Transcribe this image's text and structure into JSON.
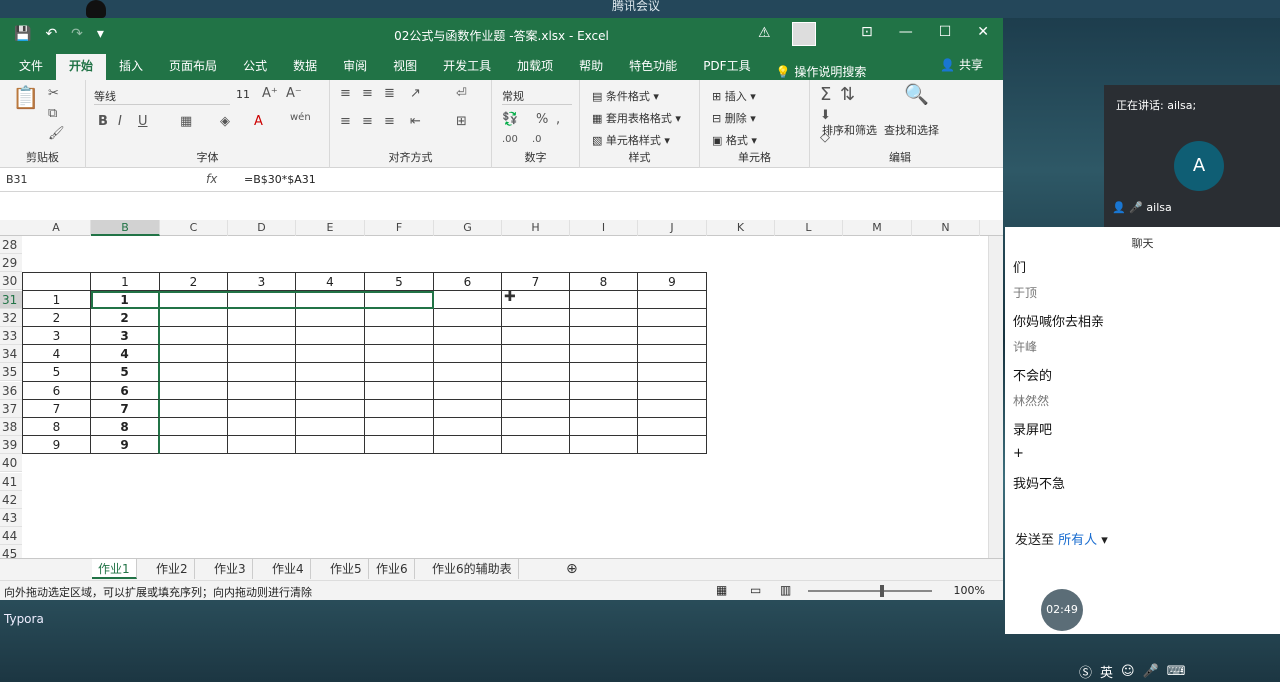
{
  "desktop": {
    "meeting_app": "腾讯会议",
    "typora": "Typora"
  },
  "window": {
    "title": "02公式与函数作业题 -答案.xlsx  -  Excel",
    "controls": [
      "⊡",
      "—",
      "☐",
      "✕"
    ]
  },
  "ribbon_tabs": [
    "文件",
    "开始",
    "插入",
    "页面布局",
    "公式",
    "数据",
    "审阅",
    "视图",
    "开发工具",
    "加载项",
    "帮助",
    "特色功能",
    "PDF工具"
  ],
  "active_tab": "开始",
  "tell_me": "操作说明搜索",
  "share": "共享",
  "ribbon": {
    "clipboard": "剪贴板",
    "font_group": "字体",
    "font_name": "等线",
    "font_size": "11",
    "align_group": "对齐方式",
    "number_group": "数字",
    "number_format": "常规",
    "styles_group": "样式",
    "cond_format": "条件格式",
    "table_format": "套用表格格式",
    "cell_styles": "单元格样式",
    "cells_group": "单元格",
    "insert": "插入",
    "delete": "删除",
    "format": "格式",
    "edit_group": "编辑",
    "sort_filter": "排序和筛选",
    "find_select": "查找和选择"
  },
  "formula_bar": {
    "name_box": "B31",
    "fx": "fx",
    "formula": "=B$30*$A31"
  },
  "columns": [
    "A",
    "B",
    "C",
    "D",
    "E",
    "F",
    "G",
    "H",
    "I",
    "J",
    "K",
    "L",
    "M",
    "N"
  ],
  "rows": [
    "28",
    "29",
    "30",
    "31",
    "32",
    "33",
    "34",
    "35",
    "36",
    "37",
    "38",
    "39",
    "40",
    "41",
    "42",
    "43",
    "44",
    "45"
  ],
  "table_header": [
    "1",
    "2",
    "3",
    "4",
    "5",
    "6",
    "7",
    "8",
    "9"
  ],
  "col_a": [
    "1",
    "2",
    "3",
    "4",
    "5",
    "6",
    "7",
    "8",
    "9"
  ],
  "col_b": [
    "1",
    "2",
    "3",
    "4",
    "5",
    "6",
    "7",
    "8",
    "9"
  ],
  "sheets": [
    "作业1",
    "作业2",
    "作业3",
    "作业4",
    "作业5",
    "作业6",
    "作业6的辅助表"
  ],
  "active_sheet": "作业1",
  "status": {
    "message": "向外拖动选定区域，可以扩展或填充序列；向内拖动则进行清除",
    "zoom": "100%"
  },
  "meeting": {
    "speaking": "正在讲话: ailsa;",
    "avatar_letter": "A",
    "user": "ailsa",
    "chat_title": "聊天",
    "messages": [
      {
        "type": "text",
        "text": "们"
      },
      {
        "type": "name",
        "text": "于顶"
      },
      {
        "type": "text",
        "text": "你妈喊你去相亲"
      },
      {
        "type": "name",
        "text": "许峰"
      },
      {
        "type": "text",
        "text": "不会的"
      },
      {
        "type": "name",
        "text": "林然然"
      },
      {
        "type": "text",
        "text": "录屏吧"
      },
      {
        "type": "text",
        "text": "+"
      },
      {
        "type": "text",
        "text": "我妈不急"
      }
    ],
    "send_to": "发送至",
    "send_target": "所有人",
    "timer": "02:49"
  },
  "tray": {
    "ime": "英"
  }
}
